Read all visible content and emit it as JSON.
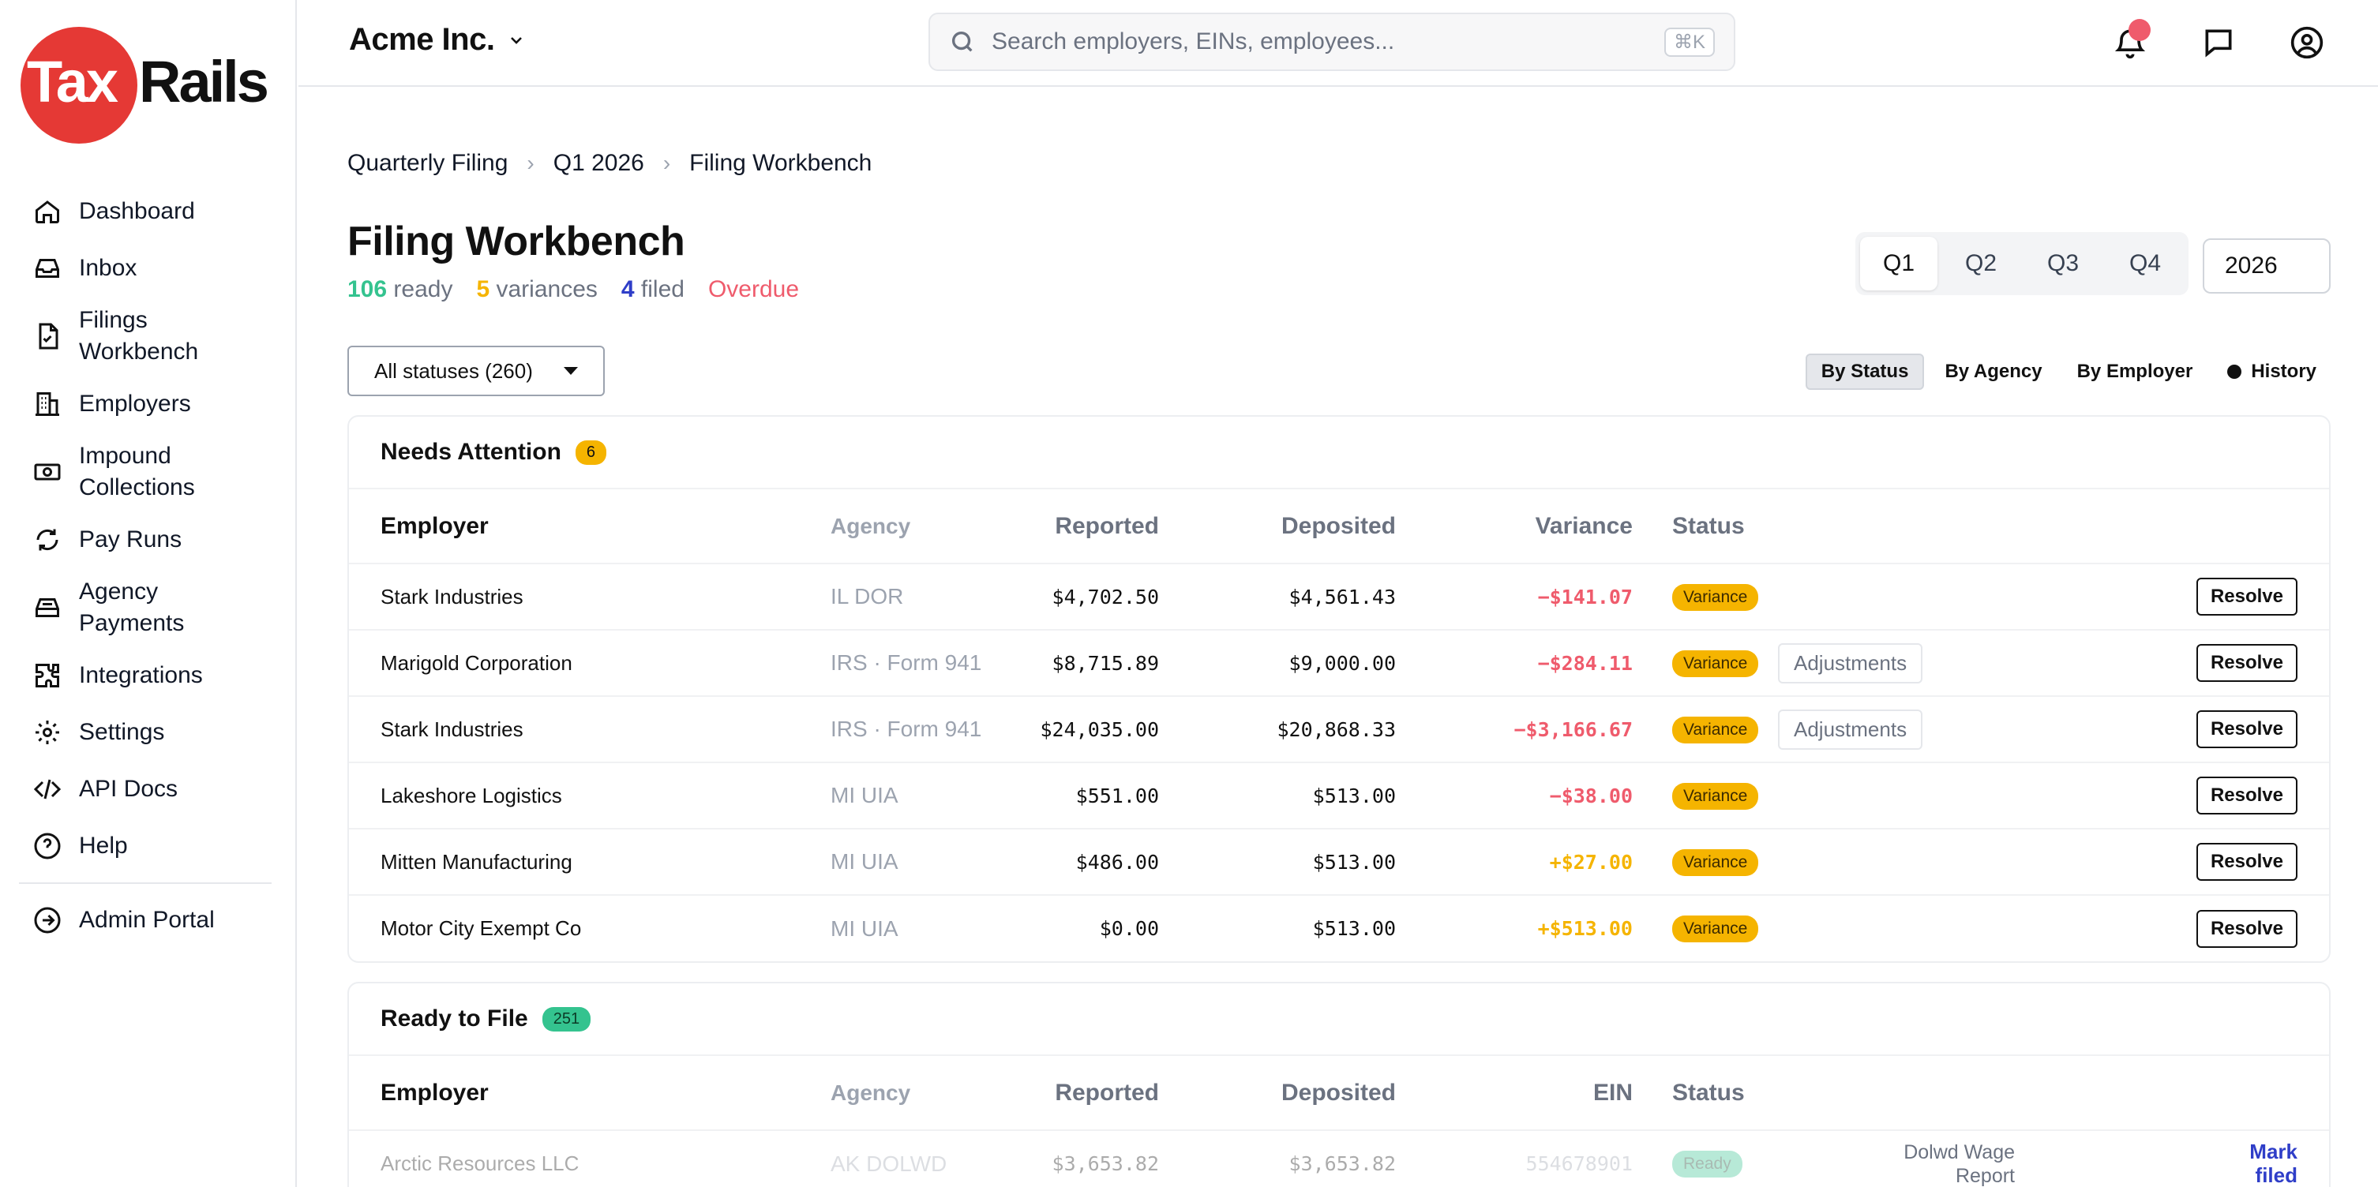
{
  "brand": {
    "tax": "Tax",
    "rails": "Rails"
  },
  "sidebar": {
    "items": [
      {
        "label": "Dashboard"
      },
      {
        "label": "Inbox"
      },
      {
        "label": "Filings Workbench"
      },
      {
        "label": "Employers"
      },
      {
        "label": "Impound Collections"
      },
      {
        "label": "Pay Runs"
      },
      {
        "label": "Agency Payments"
      },
      {
        "label": "Integrations"
      },
      {
        "label": "Settings"
      },
      {
        "label": "API Docs"
      },
      {
        "label": "Help"
      }
    ],
    "admin": "Admin Portal"
  },
  "topbar": {
    "company": "Acme Inc.",
    "search_placeholder": "Search employers, EINs, employees...",
    "search_shortcut": "⌘K"
  },
  "breadcrumb": [
    "Quarterly Filing",
    "Q1 2026",
    "Filing Workbench"
  ],
  "page": {
    "title": "Filing Workbench",
    "summary": {
      "ready_count": "106",
      "ready_label": "ready",
      "variances_count": "5",
      "variances_label": "variances",
      "filed_count": "4",
      "filed_label": "filed",
      "overdue": "Overdue"
    }
  },
  "quarters": [
    "Q1",
    "Q2",
    "Q3",
    "Q4"
  ],
  "selected_quarter": "Q1",
  "year": "2026",
  "status_filter": "All statuses (260)",
  "views": [
    "By Status",
    "By Agency",
    "By Employer",
    "History"
  ],
  "needs_attention": {
    "title": "Needs Attention",
    "count": "6",
    "columns": {
      "employer": "Employer",
      "agency": "Agency",
      "reported": "Reported",
      "deposited": "Deposited",
      "variance": "Variance",
      "status": "Status"
    },
    "rows": [
      {
        "employer": "Stark Industries",
        "agency": "IL DOR",
        "reported": "$4,702.50",
        "deposited": "$4,561.43",
        "variance": "−$141.07",
        "status": "Variance",
        "adjustments": "",
        "action": "Resolve"
      },
      {
        "employer": "Marigold Corporation",
        "agency": "IRS · Form 941",
        "reported": "$8,715.89",
        "deposited": "$9,000.00",
        "variance": "−$284.11",
        "status": "Variance",
        "adjustments": "Adjustments",
        "action": "Resolve"
      },
      {
        "employer": "Stark Industries",
        "agency": "IRS · Form 941",
        "reported": "$24,035.00",
        "deposited": "$20,868.33",
        "variance": "−$3,166.67",
        "status": "Variance",
        "adjustments": "Adjustments",
        "action": "Resolve"
      },
      {
        "employer": "Lakeshore Logistics",
        "agency": "MI UIA",
        "reported": "$551.00",
        "deposited": "$513.00",
        "variance": "−$38.00",
        "status": "Variance",
        "adjustments": "",
        "action": "Resolve"
      },
      {
        "employer": "Mitten Manufacturing",
        "agency": "MI UIA",
        "reported": "$486.00",
        "deposited": "$513.00",
        "variance": "+$27.00",
        "status": "Variance",
        "adjustments": "",
        "action": "Resolve"
      },
      {
        "employer": "Motor City Exempt Co",
        "agency": "MI UIA",
        "reported": "$0.00",
        "deposited": "$513.00",
        "variance": "+$513.00",
        "status": "Variance",
        "adjustments": "",
        "action": "Resolve"
      }
    ]
  },
  "ready_to_file": {
    "title": "Ready to File",
    "count": "251",
    "columns": {
      "employer": "Employer",
      "agency": "Agency",
      "reported": "Reported",
      "deposited": "Deposited",
      "ein": "EIN",
      "status": "Status"
    },
    "rows": [
      {
        "employer": "Arctic Resources LLC",
        "agency": "AK DOLWD",
        "reported": "$3,653.82",
        "deposited": "$3,653.82",
        "ein": "554678901",
        "status": "Ready",
        "report": "Dolwd Wage Report",
        "action": "Mark filed"
      }
    ]
  },
  "colors": {
    "accent_red": "#e53935",
    "green": "#34c38f",
    "amber": "#f5b400",
    "blue": "#2f3ec8",
    "negative": "#ef5b6c"
  }
}
